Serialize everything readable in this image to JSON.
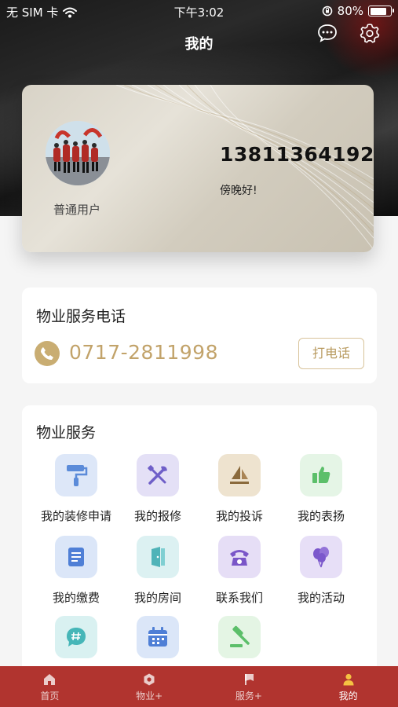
{
  "status_bar": {
    "carrier": "无 SIM 卡",
    "time": "下午3:02",
    "battery_percent": "80%",
    "battery_level": 0.8
  },
  "nav": {
    "title": "我的",
    "icons": [
      "chat-bubble-icon",
      "gear-icon"
    ]
  },
  "user_card": {
    "role": "普通用户",
    "phone": "13811364192",
    "greeting": "傍晚好!"
  },
  "hotline": {
    "title": "物业服务电话",
    "number": "0717-2811998",
    "call_button": "打电话",
    "icon": "phone-icon"
  },
  "services": {
    "title": "物业服务",
    "items": [
      {
        "label": "我的装修申请",
        "icon": "paint-roller-icon",
        "color": "#5b8bd9",
        "bg": "#dde7f8"
      },
      {
        "label": "我的报修",
        "icon": "tools-icon",
        "color": "#6f5fc8",
        "bg": "#e4e0f6"
      },
      {
        "label": "我的投诉",
        "icon": "complaint-icon",
        "color": "#8a6a3c",
        "bg": "#eee3cf"
      },
      {
        "label": "我的表扬",
        "icon": "thumbs-up-icon",
        "color": "#5cbf6a",
        "bg": "#e5f5e6"
      },
      {
        "label": "我的缴费",
        "icon": "bill-icon",
        "color": "#4f7fd6",
        "bg": "#dbe6f8"
      },
      {
        "label": "我的房间",
        "icon": "door-icon",
        "color": "#4fb3b8",
        "bg": "#dcf1f2"
      },
      {
        "label": "联系我们",
        "icon": "telephone-icon",
        "color": "#7a56c8",
        "bg": "#e6def6"
      },
      {
        "label": "我的活动",
        "icon": "balloons-icon",
        "color": "#7b58cc",
        "bg": "#e7dff7"
      },
      {
        "label": "",
        "icon": "hashtag-chat-icon",
        "color": "#46b6b8",
        "bg": "#d9f1f1"
      },
      {
        "label": "",
        "icon": "calendar-icon",
        "color": "#4f7fd6",
        "bg": "#dbe6f8"
      },
      {
        "label": "",
        "icon": "gavel-icon",
        "color": "#5cbf6a",
        "bg": "#e4f5e4"
      }
    ]
  },
  "tabbar": {
    "active": "我的",
    "items": [
      {
        "label": "首页",
        "icon": "home-icon"
      },
      {
        "label": "物业+",
        "icon": "hexagon-icon"
      },
      {
        "label": "服务+",
        "icon": "flag-icon"
      },
      {
        "label": "我的",
        "icon": "user-icon"
      }
    ]
  }
}
